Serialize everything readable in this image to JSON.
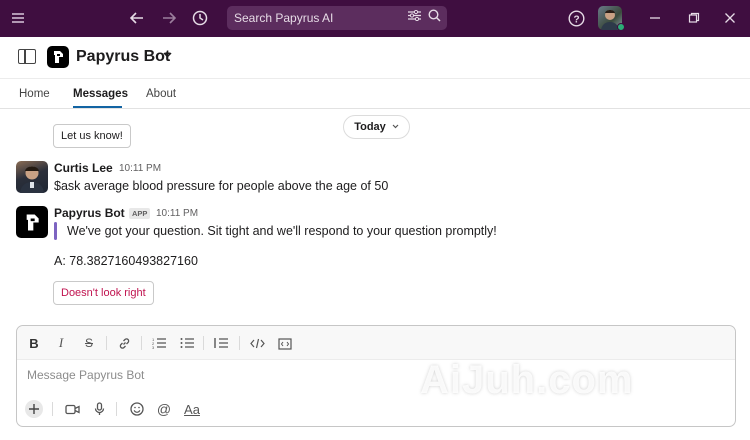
{
  "topbar": {
    "search_placeholder": "Search Papyrus AI",
    "colors": {
      "background": "#3f0e40",
      "search_bg": "#5c2d5e"
    },
    "icons": [
      "menu-icon",
      "back-arrow-icon",
      "forward-arrow-icon",
      "history-icon",
      "filter-icon",
      "search-icon",
      "help-icon",
      "minimize-icon",
      "restore-icon",
      "close-icon"
    ]
  },
  "header": {
    "title": "Papyrus Bot"
  },
  "tabs": [
    {
      "label": "Home"
    },
    {
      "label": "Messages",
      "active": true
    },
    {
      "label": "About"
    }
  ],
  "messages": {
    "prev_button": "Let us know!",
    "date_divider": "Today",
    "user_message": {
      "sender": "Curtis Lee",
      "time": "10:11 PM",
      "text": "$ask average blood pressure for people above the age of 50"
    },
    "bot_message": {
      "sender": "Papyrus Bot",
      "badge": "APP",
      "time": "10:11 PM",
      "quote": "We've got your question. Sit tight and we'll respond to your question promptly!",
      "answer": "A: 78.3827160493827160",
      "feedback_button": "Doesn't look right"
    }
  },
  "composer": {
    "placeholder": "Message Papyrus Bot",
    "format_label": "Aa"
  },
  "watermark": "AiJuh.com"
}
